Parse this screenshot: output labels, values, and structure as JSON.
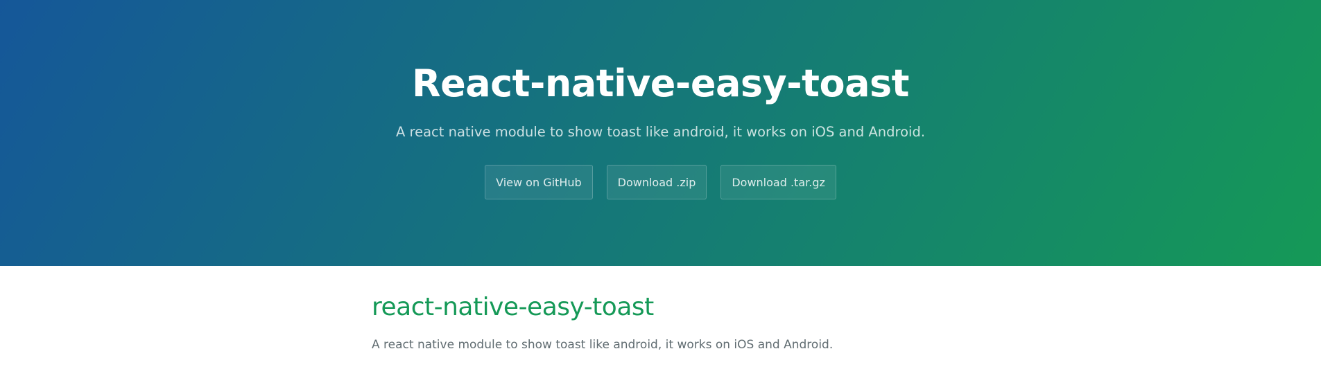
{
  "header": {
    "project_name": "React-native-easy-toast",
    "tagline": "A react native module to show toast like android, it works on iOS and Android.",
    "buttons": [
      {
        "label": "View on GitHub"
      },
      {
        "label": "Download .zip"
      },
      {
        "label": "Download .tar.gz"
      }
    ]
  },
  "main": {
    "title": "react-native-easy-toast",
    "description": "A react native module to show toast like android, it works on iOS and Android."
  },
  "colors": {
    "gradient_start": "#155799",
    "gradient_end": "#159957",
    "heading_green": "#159957",
    "body_text": "#606c71"
  }
}
